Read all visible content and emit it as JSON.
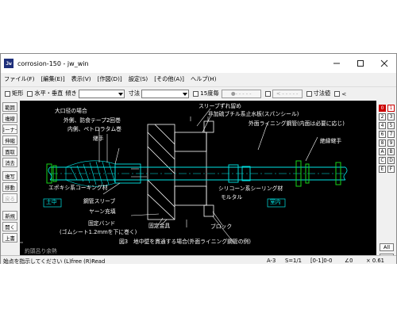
{
  "window": {
    "title": "corrosion-150 - jw_win",
    "icon_text": "Jw",
    "controls": [
      "minimize",
      "maximize",
      "close"
    ]
  },
  "menu": [
    "ファイル(F)",
    "[編集(E)]",
    "表示(V)",
    "[作図(D)]",
    "設定(S)",
    "[その他(A)]",
    "ヘルプ(H)"
  ],
  "toolbar": {
    "rect_label": "矩形",
    "hv_label": "水平・垂直",
    "tilt_label": "傾き",
    "dim_label": "寸法",
    "deg15_label": "15度毎",
    "dash1": "●- - - - -",
    "dash2": "< - - - - -",
    "dimval_label": "寸法値",
    "lt_label": "<"
  },
  "left_buttons": [
    "範囲",
    "複線",
    "コーナー",
    "伸縮",
    "面取",
    "消去",
    "複写",
    "移動",
    "戻る",
    "新規",
    "開く",
    "上書"
  ],
  "right_buttons": {
    "left_col": [
      "0",
      "2",
      "4",
      "6",
      "8",
      "A",
      "C",
      "E"
    ],
    "right_col": [
      "1",
      "3",
      "5",
      "7",
      "9",
      "B",
      "D",
      "F"
    ],
    "all_label": "All",
    "x_label": "✕",
    "bottom_left": [
      "0",
      "1",
      "2"
    ],
    "bottom_right": [
      "8",
      "9",
      "A"
    ]
  },
  "drawing": {
    "labels": {
      "sleeve_stop": "スリーブずれ留め",
      "rubber_plate": "非加硫ブチル系止水板(スパンシール)",
      "outer_lining": "外面ライニング鋼管(内面は必要に応じ)",
      "large_dia": "大口径の場合",
      "outer_tape": "外側、防食テープ2回巻",
      "inner_petro": "内側、ペトロラタム巻",
      "joint": "継手",
      "insulation_joint": "絶縁継手",
      "epoxy": "エポキシ系コーキング材",
      "silicone": "シリコーン系シーリング材",
      "mortar": "モルタル",
      "soil": "土中",
      "indoor": "室内",
      "steel_sleeve": "鋼管スリーブ",
      "yarn": "ヤーン充填",
      "band": "固定バンド",
      "band_note": "(ゴムシート1.2mmを下に巻く)",
      "fixture": "固定金具",
      "block": "ブロック",
      "caption": "図3　地中壁を貫通する場合(外面ライニング鋼管の例)",
      "tail_text": "約頭呂り余熱"
    }
  },
  "status": {
    "message": "始点を指示してください (L)free (R)Read",
    "paper": "A-3",
    "scale": "S=1/1",
    "layer": "[0-1]0-0",
    "angle": "∠0",
    "zoom": "× 0.61"
  },
  "colors": {
    "canvas_bg": "#000000",
    "draw_white": "#ffffff",
    "draw_cyan": "#00e6e6",
    "draw_green": "#19d419",
    "accent_red": "#cc0000"
  }
}
